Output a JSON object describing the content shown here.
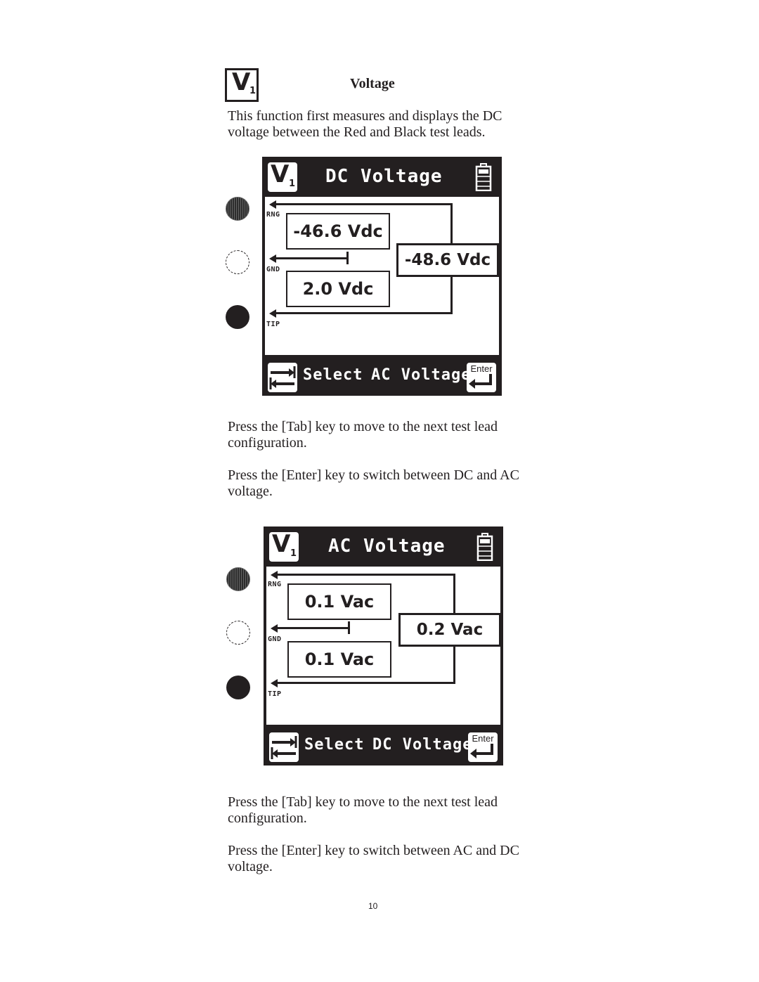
{
  "section": {
    "icon": "voltage-v1-icon",
    "badge_letter": "V",
    "badge_sub": "1",
    "heading": "Voltage",
    "intro": "This function first measures and displays the DC voltage between the Red and Black test leads."
  },
  "screens": [
    {
      "title": "DC Voltage",
      "badge_letter": "V",
      "badge_sub": "1",
      "battery_icon": "battery-full-icon",
      "leads": {
        "ring": "RNG",
        "ground": "GND",
        "tip": "TIP"
      },
      "readings": {
        "ring_to_ground": "-46.6 Vdc",
        "tip_to_ground": "2.0 Vdc",
        "ring_to_tip": "-48.6 Vdc"
      },
      "footer": {
        "tab_icon": "tab-icon",
        "select_label": "Select",
        "enter_action_label": "AC Voltage",
        "enter_key_label": "Enter",
        "enter_icon": "enter-icon"
      }
    },
    {
      "title": "AC Voltage",
      "badge_letter": "V",
      "badge_sub": "1",
      "battery_icon": "battery-full-icon",
      "leads": {
        "ring": "RNG",
        "ground": "GND",
        "tip": "TIP"
      },
      "readings": {
        "ring_to_ground": "0.1 Vac",
        "tip_to_ground": "0.1 Vac",
        "ring_to_tip": "0.2 Vac"
      },
      "footer": {
        "tab_icon": "tab-icon",
        "select_label": "Select",
        "enter_action_label": "DC Voltage",
        "enter_key_label": "Enter",
        "enter_icon": "enter-icon"
      }
    }
  ],
  "instructions_1": {
    "tab": "Press the [Tab] key to move to the next test lead configuration.",
    "enter": "Press the [Enter] key to switch between DC and AC voltage."
  },
  "instructions_2": {
    "tab": "Press the [Tab] key to move to the next test lead configuration.",
    "enter": "Press the [Enter] key to switch between AC and DC voltage."
  },
  "page_number": "10"
}
